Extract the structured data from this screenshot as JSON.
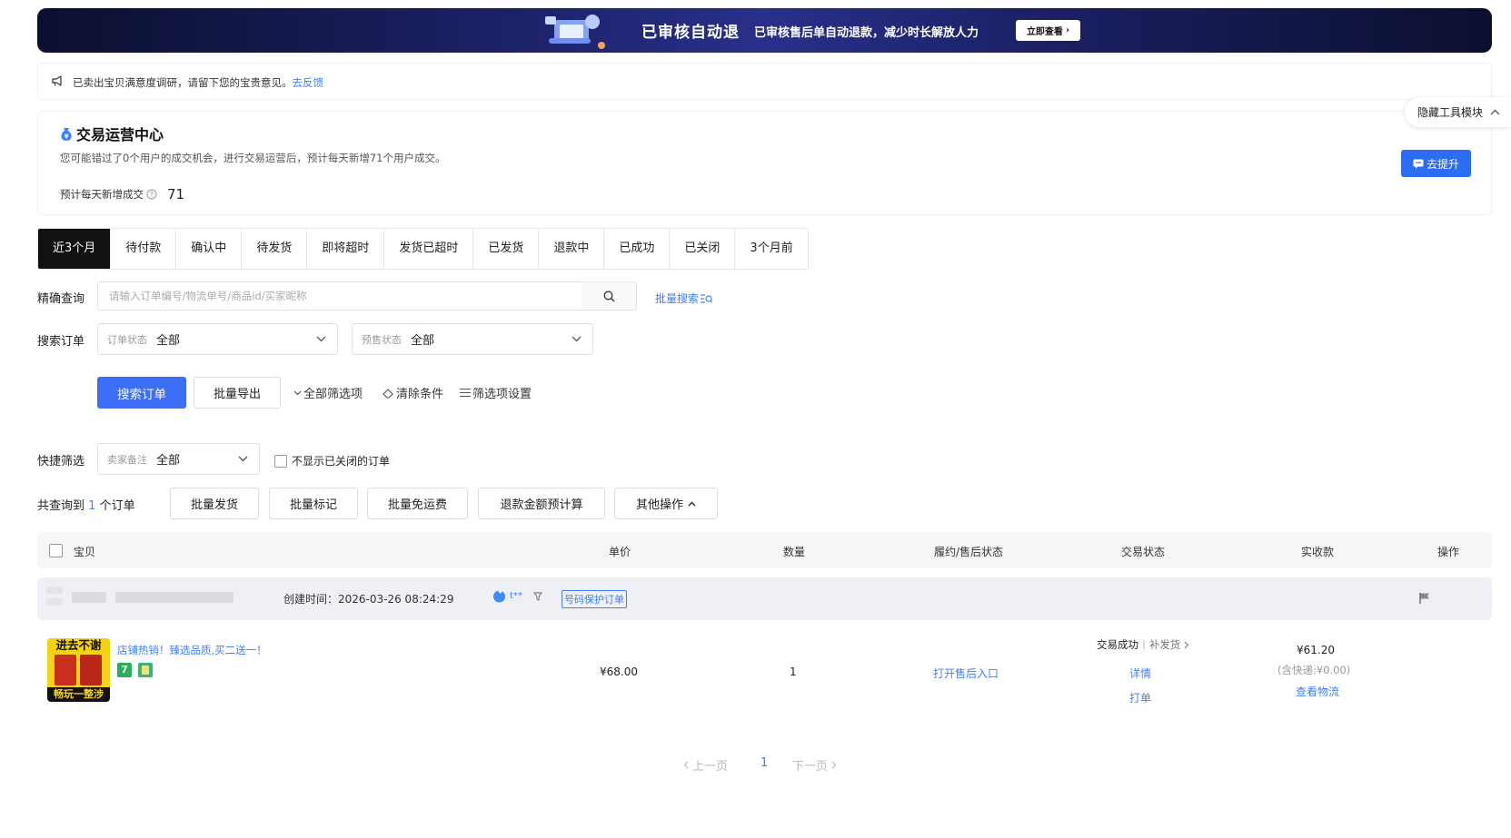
{
  "banner": {
    "title": "已审核自动退",
    "subtitle": "已审核售后单自动退款，减少时长解放人力",
    "button": "立即查看"
  },
  "notice": {
    "text": "已卖出宝贝满意度调研，请留下您的宝贵意见。",
    "link": "去反馈"
  },
  "ops_center": {
    "title": "交易运营中心",
    "description": "您可能错过了0个用户的成交机会，进行交易运营后，预计每天新增71个用户成交。",
    "metric_label": "预计每天新增成交",
    "metric_value": "71",
    "button": "去提升"
  },
  "hide_tools": "隐藏工具模块",
  "tabs": [
    "近3个月",
    "待付款",
    "确认中",
    "待发货",
    "即将超时",
    "发货已超时",
    "已发货",
    "退款中",
    "已成功",
    "已关闭",
    "3个月前"
  ],
  "search": {
    "label": "精确查询",
    "placeholder": "请输入订单编号/物流单号/商品id/买家昵称",
    "batch_search": "批量搜索"
  },
  "filter": {
    "label": "搜索订单",
    "order_status_label": "订单状态",
    "order_status_value": "全部",
    "presale_status_label": "预售状态",
    "presale_status_value": "全部"
  },
  "actions": {
    "search_order": "搜索订单",
    "batch_export": "批量导出",
    "all_filters": "全部筛选项",
    "clear": "清除条件",
    "filter_settings": "筛选项设置"
  },
  "quick_filter": {
    "label": "快捷筛选",
    "seller_note_label": "卖家备注",
    "seller_note_value": "全部",
    "hide_closed": "不显示已关闭的订单"
  },
  "result": {
    "prefix": "共查询到",
    "count": "1",
    "suffix": "个订单"
  },
  "batch_buttons": [
    "批量发货",
    "批量标记",
    "批量免运费",
    "退款金额预计算",
    "其他操作"
  ],
  "table": {
    "headers": {
      "item": "宝贝",
      "price": "单价",
      "qty": "数量",
      "after_sale": "履约/售后状态",
      "trade_status": "交易状态",
      "received": "实收款",
      "ops": "操作"
    }
  },
  "order": {
    "created": "创建时间：2026-03-26 08:24:29",
    "protect_tag": "号码保护订单",
    "buyer_suffix": "t**",
    "product_title": "店铺热销！臻选品质,买二送一！",
    "img_top_text": "进去不谢",
    "img_bottom_text": "畅玩一整涉",
    "unit_price": "¥68.00",
    "quantity": "1",
    "after_sale_link": "打开售后入口",
    "trade_status": "交易成功",
    "trade_extra": "补发货",
    "detail": "详情",
    "print": "打单",
    "received": "¥61.20",
    "shipping_note": "(含快递:¥0.00)",
    "logistics": "查看物流"
  },
  "pager": {
    "prev": "上一页",
    "page": "1",
    "next": "下一页"
  },
  "colors": {
    "primary": "#3c6df5",
    "link": "#3d7fff",
    "active_tab": "#111111"
  }
}
